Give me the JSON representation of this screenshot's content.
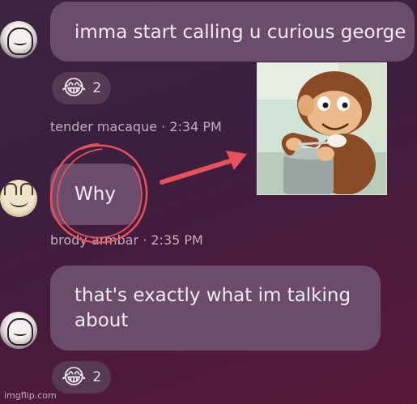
{
  "messages": [
    {
      "text": "imma start calling u curious george",
      "reaction": {
        "emoji": "😂",
        "count": "2"
      },
      "meta": "tender macaque · 2:34 PM"
    },
    {
      "text": "Why",
      "meta": "brody armbar · 2:35 PM"
    },
    {
      "text_line1": "that's exactly what im talking",
      "text_line2": "about",
      "reaction": {
        "emoji": "😂",
        "count": "2"
      }
    }
  ],
  "annotation_color": "#e8505b",
  "watermark": "imgflip.com"
}
